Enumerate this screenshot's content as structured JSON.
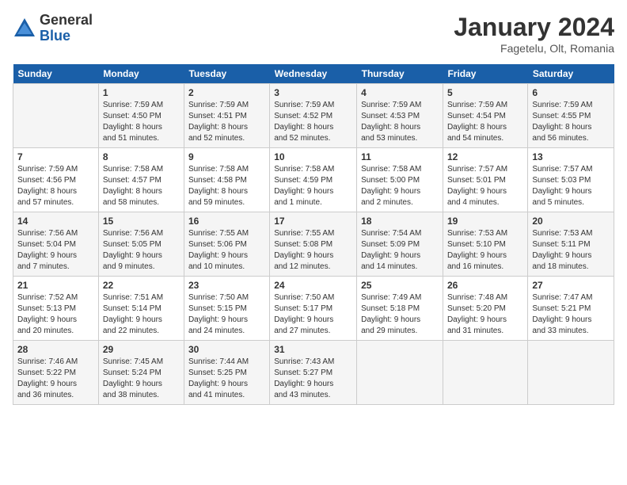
{
  "header": {
    "logo": {
      "general": "General",
      "blue": "Blue"
    },
    "title": "January 2024",
    "location": "Fagetelu, Olt, Romania"
  },
  "days_of_week": [
    "Sunday",
    "Monday",
    "Tuesday",
    "Wednesday",
    "Thursday",
    "Friday",
    "Saturday"
  ],
  "weeks": [
    [
      {
        "day": "",
        "info": ""
      },
      {
        "day": "1",
        "info": "Sunrise: 7:59 AM\nSunset: 4:50 PM\nDaylight: 8 hours\nand 51 minutes."
      },
      {
        "day": "2",
        "info": "Sunrise: 7:59 AM\nSunset: 4:51 PM\nDaylight: 8 hours\nand 52 minutes."
      },
      {
        "day": "3",
        "info": "Sunrise: 7:59 AM\nSunset: 4:52 PM\nDaylight: 8 hours\nand 52 minutes."
      },
      {
        "day": "4",
        "info": "Sunrise: 7:59 AM\nSunset: 4:53 PM\nDaylight: 8 hours\nand 53 minutes."
      },
      {
        "day": "5",
        "info": "Sunrise: 7:59 AM\nSunset: 4:54 PM\nDaylight: 8 hours\nand 54 minutes."
      },
      {
        "day": "6",
        "info": "Sunrise: 7:59 AM\nSunset: 4:55 PM\nDaylight: 8 hours\nand 56 minutes."
      }
    ],
    [
      {
        "day": "7",
        "info": "Sunrise: 7:59 AM\nSunset: 4:56 PM\nDaylight: 8 hours\nand 57 minutes."
      },
      {
        "day": "8",
        "info": "Sunrise: 7:58 AM\nSunset: 4:57 PM\nDaylight: 8 hours\nand 58 minutes."
      },
      {
        "day": "9",
        "info": "Sunrise: 7:58 AM\nSunset: 4:58 PM\nDaylight: 8 hours\nand 59 minutes."
      },
      {
        "day": "10",
        "info": "Sunrise: 7:58 AM\nSunset: 4:59 PM\nDaylight: 9 hours\nand 1 minute."
      },
      {
        "day": "11",
        "info": "Sunrise: 7:58 AM\nSunset: 5:00 PM\nDaylight: 9 hours\nand 2 minutes."
      },
      {
        "day": "12",
        "info": "Sunrise: 7:57 AM\nSunset: 5:01 PM\nDaylight: 9 hours\nand 4 minutes."
      },
      {
        "day": "13",
        "info": "Sunrise: 7:57 AM\nSunset: 5:03 PM\nDaylight: 9 hours\nand 5 minutes."
      }
    ],
    [
      {
        "day": "14",
        "info": "Sunrise: 7:56 AM\nSunset: 5:04 PM\nDaylight: 9 hours\nand 7 minutes."
      },
      {
        "day": "15",
        "info": "Sunrise: 7:56 AM\nSunset: 5:05 PM\nDaylight: 9 hours\nand 9 minutes."
      },
      {
        "day": "16",
        "info": "Sunrise: 7:55 AM\nSunset: 5:06 PM\nDaylight: 9 hours\nand 10 minutes."
      },
      {
        "day": "17",
        "info": "Sunrise: 7:55 AM\nSunset: 5:08 PM\nDaylight: 9 hours\nand 12 minutes."
      },
      {
        "day": "18",
        "info": "Sunrise: 7:54 AM\nSunset: 5:09 PM\nDaylight: 9 hours\nand 14 minutes."
      },
      {
        "day": "19",
        "info": "Sunrise: 7:53 AM\nSunset: 5:10 PM\nDaylight: 9 hours\nand 16 minutes."
      },
      {
        "day": "20",
        "info": "Sunrise: 7:53 AM\nSunset: 5:11 PM\nDaylight: 9 hours\nand 18 minutes."
      }
    ],
    [
      {
        "day": "21",
        "info": "Sunrise: 7:52 AM\nSunset: 5:13 PM\nDaylight: 9 hours\nand 20 minutes."
      },
      {
        "day": "22",
        "info": "Sunrise: 7:51 AM\nSunset: 5:14 PM\nDaylight: 9 hours\nand 22 minutes."
      },
      {
        "day": "23",
        "info": "Sunrise: 7:50 AM\nSunset: 5:15 PM\nDaylight: 9 hours\nand 24 minutes."
      },
      {
        "day": "24",
        "info": "Sunrise: 7:50 AM\nSunset: 5:17 PM\nDaylight: 9 hours\nand 27 minutes."
      },
      {
        "day": "25",
        "info": "Sunrise: 7:49 AM\nSunset: 5:18 PM\nDaylight: 9 hours\nand 29 minutes."
      },
      {
        "day": "26",
        "info": "Sunrise: 7:48 AM\nSunset: 5:20 PM\nDaylight: 9 hours\nand 31 minutes."
      },
      {
        "day": "27",
        "info": "Sunrise: 7:47 AM\nSunset: 5:21 PM\nDaylight: 9 hours\nand 33 minutes."
      }
    ],
    [
      {
        "day": "28",
        "info": "Sunrise: 7:46 AM\nSunset: 5:22 PM\nDaylight: 9 hours\nand 36 minutes."
      },
      {
        "day": "29",
        "info": "Sunrise: 7:45 AM\nSunset: 5:24 PM\nDaylight: 9 hours\nand 38 minutes."
      },
      {
        "day": "30",
        "info": "Sunrise: 7:44 AM\nSunset: 5:25 PM\nDaylight: 9 hours\nand 41 minutes."
      },
      {
        "day": "31",
        "info": "Sunrise: 7:43 AM\nSunset: 5:27 PM\nDaylight: 9 hours\nand 43 minutes."
      },
      {
        "day": "",
        "info": ""
      },
      {
        "day": "",
        "info": ""
      },
      {
        "day": "",
        "info": ""
      }
    ]
  ]
}
